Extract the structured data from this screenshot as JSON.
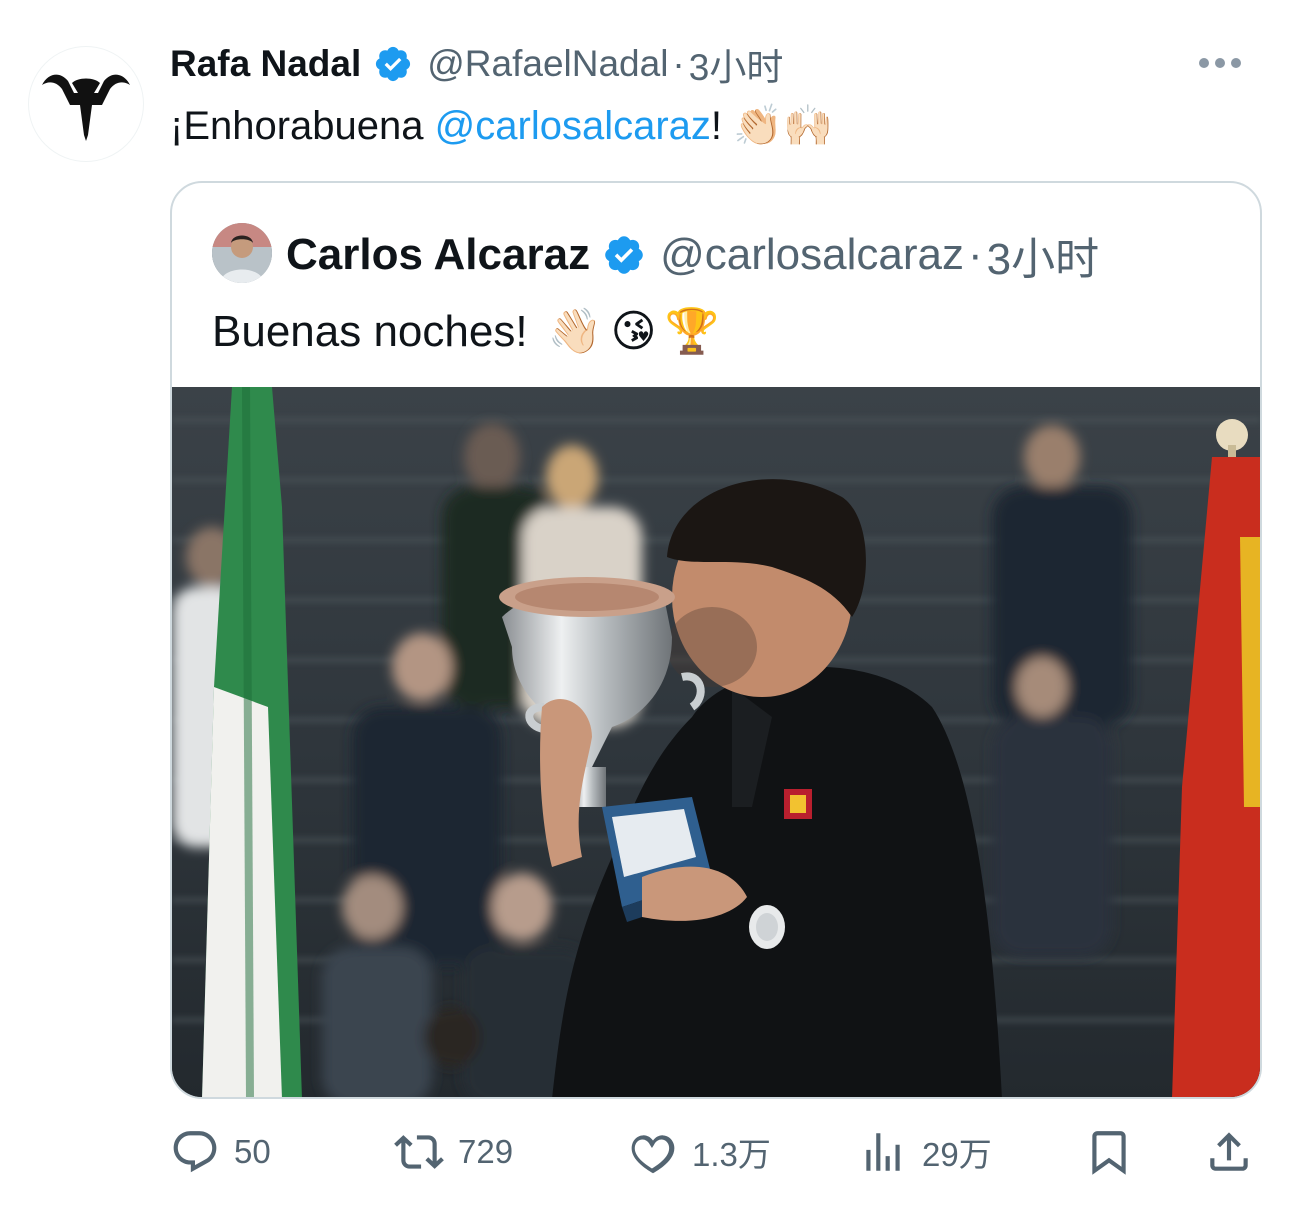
{
  "author": {
    "display_name": "Rafa Nadal",
    "handle": "@RafaelNadal",
    "separator": "·",
    "time": "3小时",
    "avatar_icon": "bull-logo-icon",
    "verified_icon": "verified-badge-icon"
  },
  "tweet": {
    "text_before": "¡Enhorabuena ",
    "mention": "@carlosalcaraz",
    "text_after": "!",
    "emojis": [
      "👏🏻",
      "🙌🏻"
    ]
  },
  "more_icon": "more-options-icon",
  "quoted": {
    "display_name": "Carlos Alcaraz",
    "handle": "@carlosalcaraz",
    "separator": "·",
    "time": "3小时",
    "text": "Buenas noches!",
    "emojis": [
      "👋🏻",
      "😘",
      "🏆"
    ],
    "photo_icon": "trophy-photo"
  },
  "actions": {
    "reply": {
      "icon": "reply-icon",
      "count": "50"
    },
    "retweet": {
      "icon": "retweet-icon",
      "count": "729"
    },
    "like": {
      "icon": "heart-icon",
      "count": "1.3万"
    },
    "views": {
      "icon": "views-chart-icon",
      "count": "29万"
    },
    "bookmark": {
      "icon": "bookmark-icon"
    },
    "share": {
      "icon": "share-icon"
    }
  },
  "colors": {
    "accent": "#1d9bf0",
    "muted": "#536471",
    "text": "#0f1419",
    "border": "#cfd9de"
  }
}
